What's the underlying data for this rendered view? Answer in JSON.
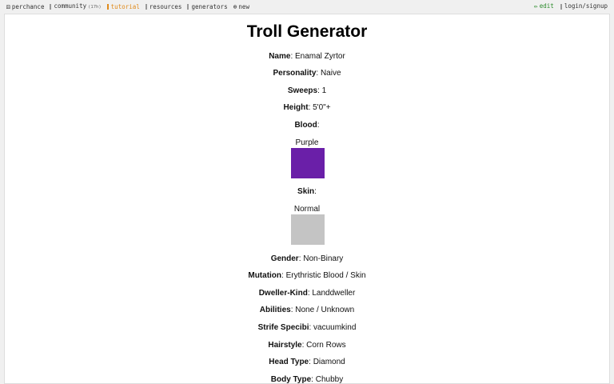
{
  "topbar": {
    "perchance": "perchance",
    "community": "community",
    "community_tag": "(17h)",
    "tutorial": "tutorial",
    "resources": "resources",
    "generators": "generators",
    "new": "new",
    "edit": "edit",
    "login": "login/signup"
  },
  "page": {
    "title": "Troll Generator",
    "name_label": "Name",
    "name_value": "Enamal Zyrtor",
    "personality_label": "Personality",
    "personality_value": "Naive",
    "sweeps_label": "Sweeps",
    "sweeps_value": "1",
    "height_label": "Height",
    "height_value": "5'0\"+",
    "blood_label": "Blood",
    "blood_value": "Purple",
    "blood_color": "#6a1fa8",
    "skin_label": "Skin",
    "skin_value": "Normal",
    "skin_color": "#c4c4c4",
    "gender_label": "Gender",
    "gender_value": "Non-Binary",
    "mutation_label": "Mutation",
    "mutation_value": "Erythristic Blood / Skin",
    "dweller_label": "Dweller-Kind",
    "dweller_value": "Landdweller",
    "abilities_label": "Abilities",
    "abilities_value": "None / Unknown",
    "strife_label": "Strife Specibi",
    "strife_value": "vacuumkind",
    "hairstyle_label": "Hairstyle",
    "hairstyle_value": "Corn Rows",
    "headtype_label": "Head Type",
    "headtype_value": "Diamond",
    "bodytype_label": "Body Type",
    "bodytype_value": "Chubby"
  }
}
